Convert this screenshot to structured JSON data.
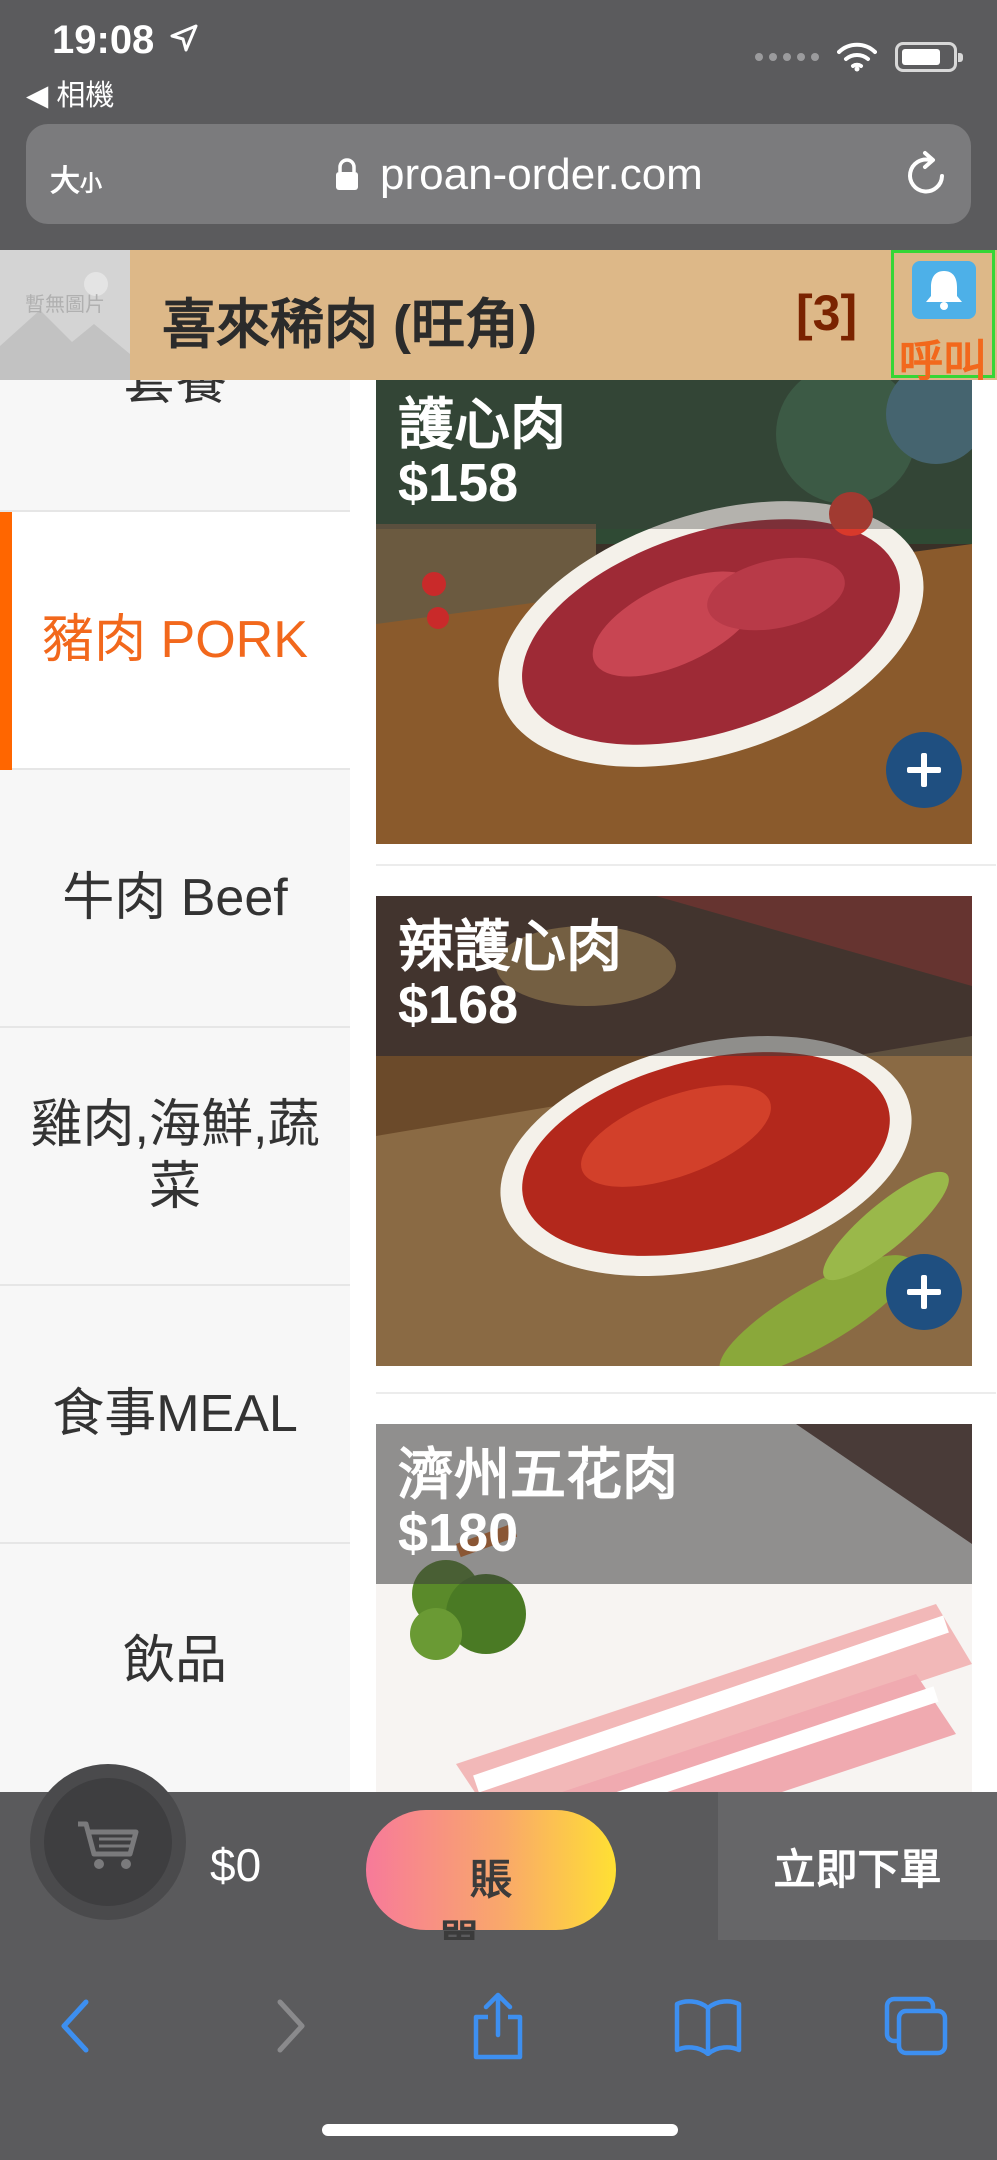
{
  "status": {
    "time": "19:08",
    "back_app": "◀ 相機"
  },
  "browser": {
    "text_size_label": "大",
    "text_size_small": "小",
    "url": "proan-order.com"
  },
  "store": {
    "logo_placeholder": "暫無圖片",
    "name": "喜來稀肉 (旺角)",
    "count": "[3]",
    "call_label": "呼叫"
  },
  "categories": [
    {
      "label": "套餐",
      "active": false
    },
    {
      "label": "豬肉 PORK",
      "active": true
    },
    {
      "label": "牛肉 Beef",
      "active": false
    },
    {
      "label": "雞肉,海鮮,蔬菜",
      "active": false
    },
    {
      "label": "食事MEAL",
      "active": false
    },
    {
      "label": "飲品",
      "active": false
    }
  ],
  "products": [
    {
      "name": "護心肉",
      "price": "$158"
    },
    {
      "name": "辣護心肉",
      "price": "$168"
    },
    {
      "name": "濟州五花肉",
      "price": "$180"
    }
  ],
  "cart": {
    "total": "$0",
    "bill_label": "賬單",
    "order_now_label": "立即下單"
  },
  "colors": {
    "accent": "#ff6600",
    "header": "#ddb888",
    "add_button": "#1f4f80",
    "toolbar_icons": "#3d8ff0"
  }
}
